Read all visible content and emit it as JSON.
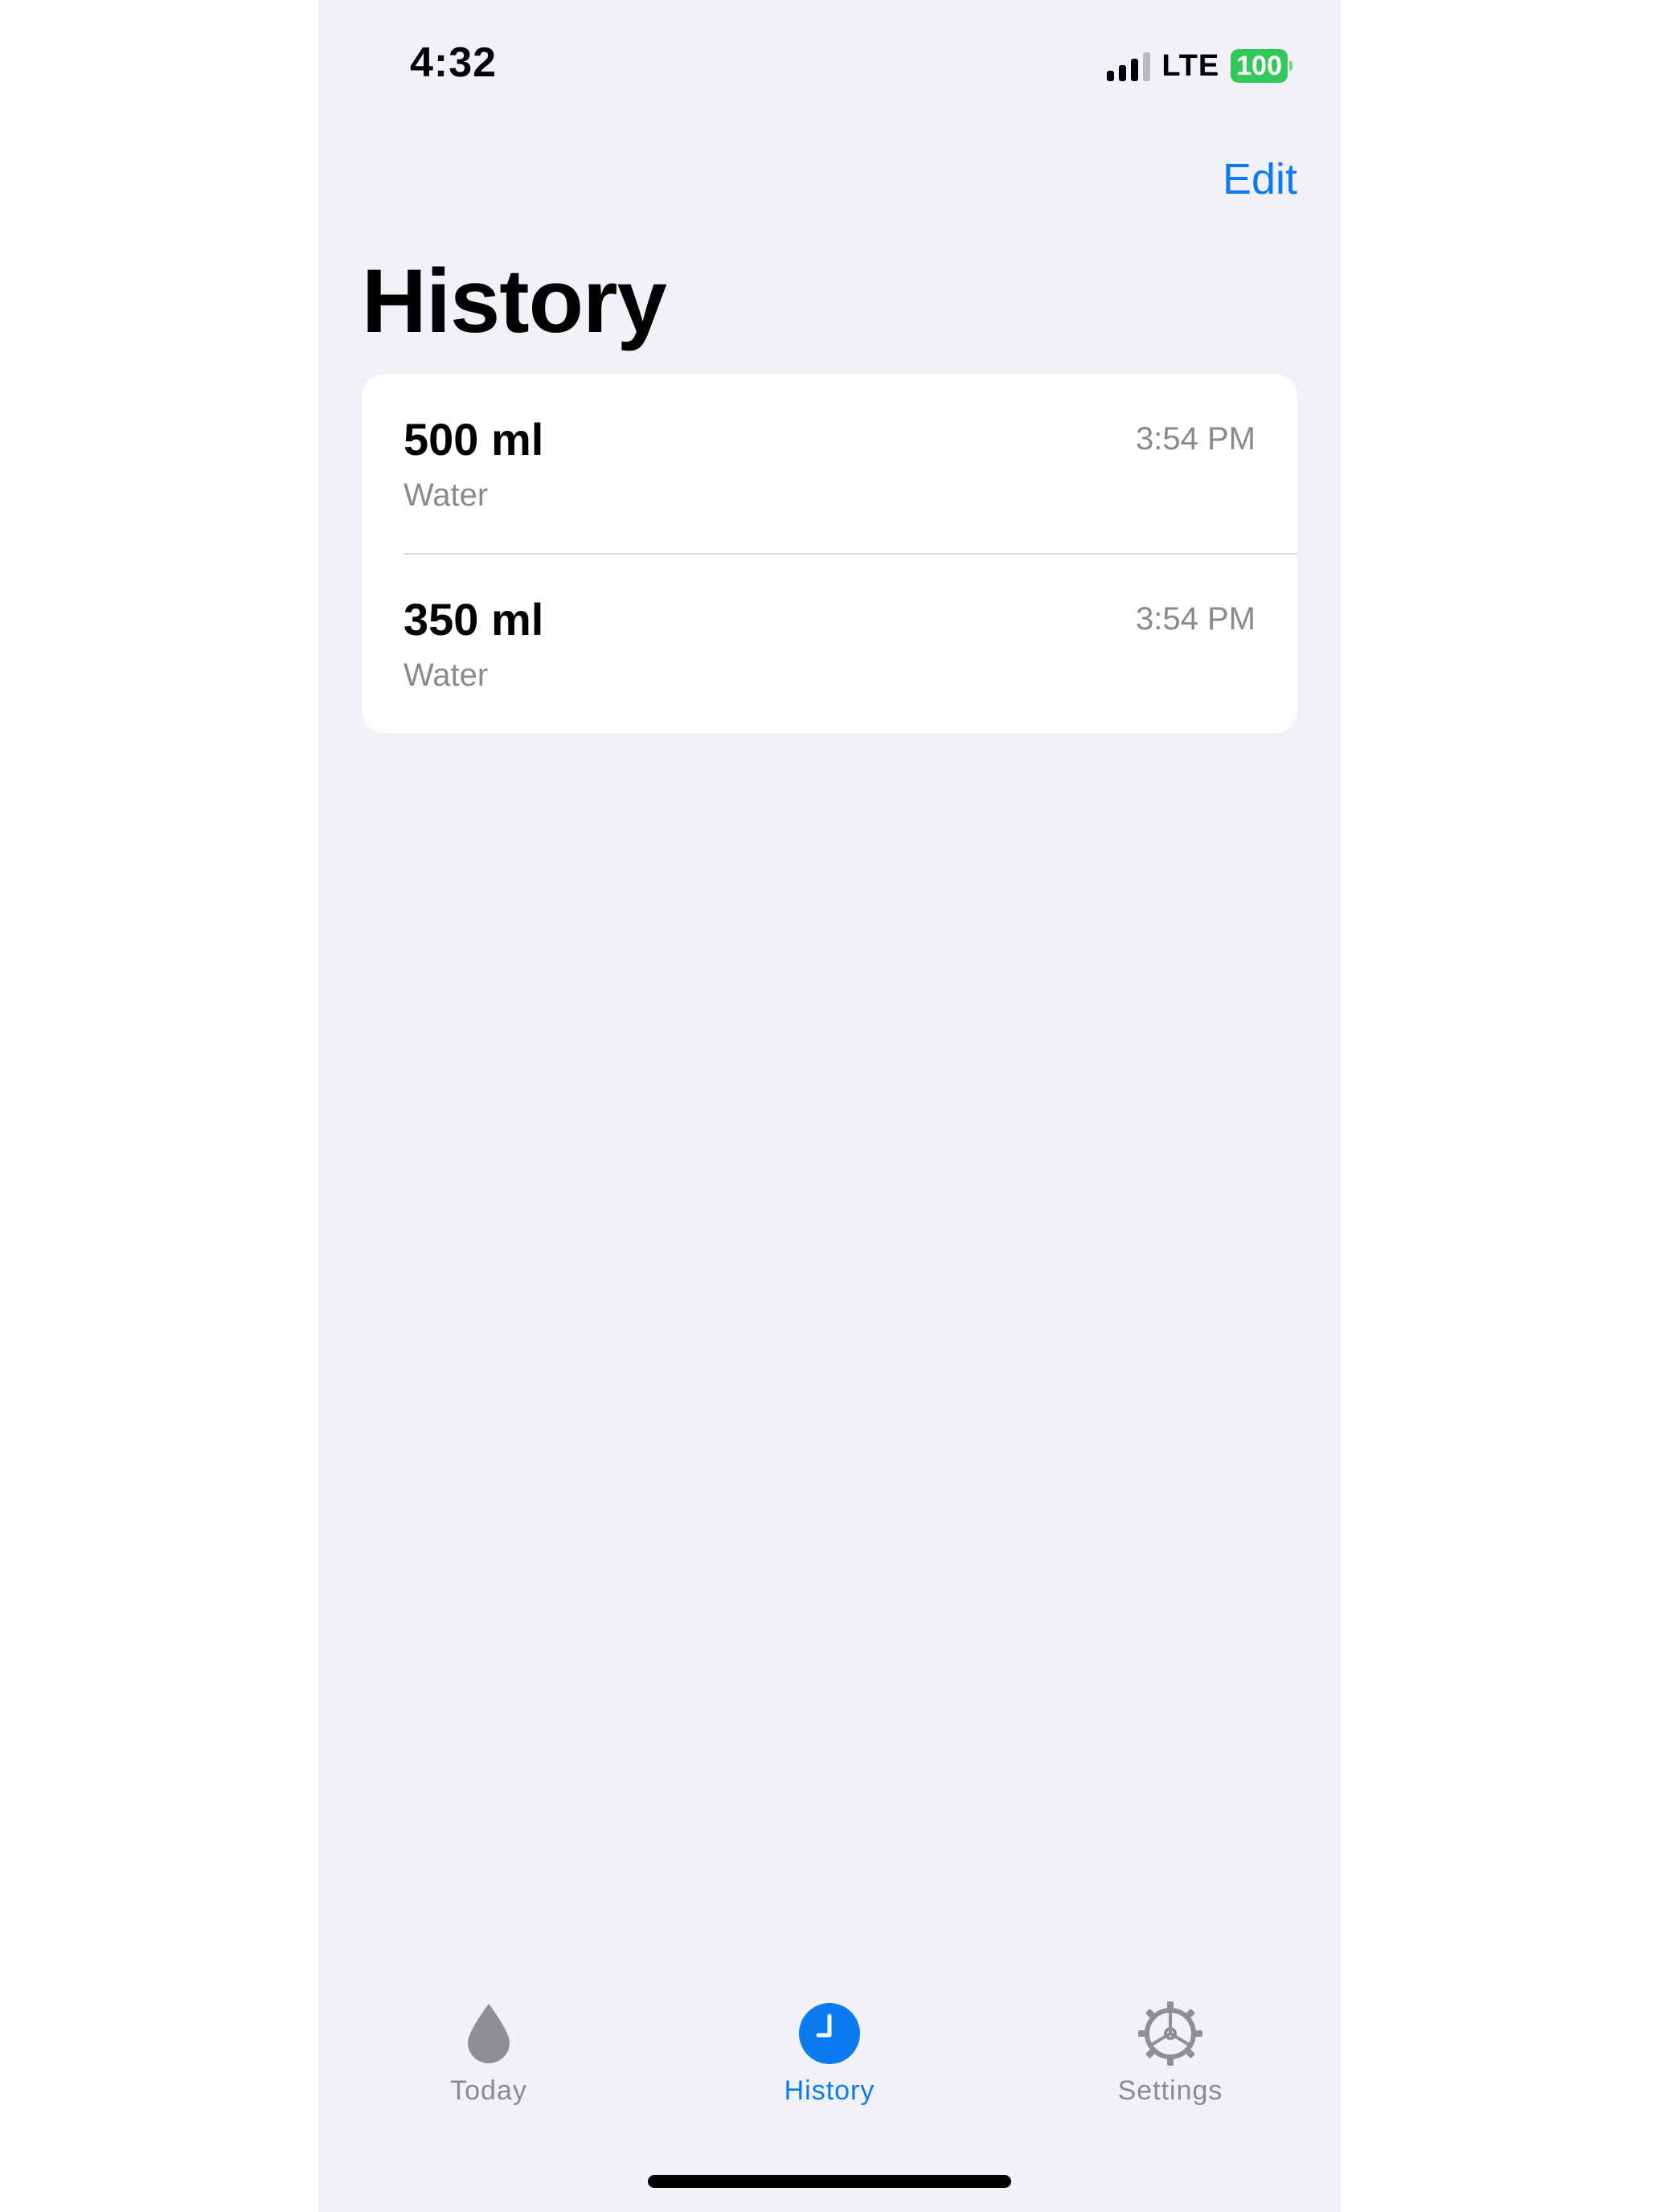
{
  "status_bar": {
    "time": "4:32",
    "network": "LTE",
    "battery": "100",
    "signal_bars_active": 3,
    "signal_bars_total": 4
  },
  "nav": {
    "edit_label": "Edit",
    "title": "History"
  },
  "entries": [
    {
      "amount": "500 ml",
      "type": "Water",
      "time": "3:54 PM"
    },
    {
      "amount": "350 ml",
      "type": "Water",
      "time": "3:54 PM"
    }
  ],
  "tabs": [
    {
      "label": "Today",
      "icon": "drop-icon",
      "active": false
    },
    {
      "label": "History",
      "icon": "clock-icon",
      "active": true
    },
    {
      "label": "Settings",
      "icon": "gear-icon",
      "active": false
    }
  ],
  "colors": {
    "accent": "#0a7cf0",
    "background": "#f2f1f7",
    "battery": "#34c759",
    "inactive": "#8a8a8e"
  }
}
